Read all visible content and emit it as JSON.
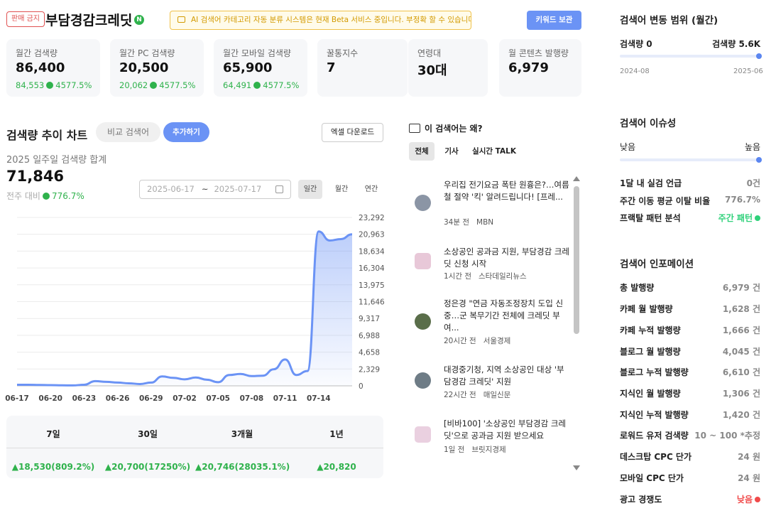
{
  "header": {
    "ban_badge": "판매 금지",
    "keyword": "부담경감크레딧",
    "n_icon": "N",
    "beta_note": "AI 검색어 카테고리 자동 분류 시스템은 현재 Beta 서비스 중입니다. 부정확 할 수 있습니다.",
    "keep_button": "키워드 보관"
  },
  "stats": [
    {
      "label": "월간 검색량",
      "value": "86,400",
      "sub_value": "84,553",
      "sub_pct": "4577.5%"
    },
    {
      "label": "월간 PC 검색량",
      "value": "20,500",
      "sub_value": "20,062",
      "sub_pct": "4577.5%"
    },
    {
      "label": "월간 모바일 검색량",
      "value": "65,900",
      "sub_value": "64,491",
      "sub_pct": "4577.5%"
    },
    {
      "label": "꿀통지수",
      "value": "7"
    },
    {
      "label": "연령대",
      "value": "30대"
    },
    {
      "label": "월 콘텐츠 발행량",
      "value": "6,979"
    }
  ],
  "trend": {
    "title": "검색량 추이 차트",
    "compare_button": "비교 검색어",
    "add_button": "추가하기",
    "excel_button": "엑셀 다운로드",
    "sum_label": "2025 일주일 검색량 합계",
    "sum_value": "71,846",
    "wow_label": "전주 대비",
    "wow_value": "776.7%",
    "date_from": "2025-06-17",
    "date_sep": "~",
    "date_to": "2025-07-17",
    "periods": [
      "일간",
      "월간",
      "연간"
    ],
    "active_period": "일간"
  },
  "chart_data": {
    "type": "area",
    "x_ticks": [
      "06-17",
      "06-20",
      "06-23",
      "06-26",
      "06-29",
      "07-02",
      "07-05",
      "07-08",
      "07-11",
      "07-14"
    ],
    "y_ticks": [
      "23,292",
      "20,963",
      "18,634",
      "16,304",
      "13,975",
      "11,646",
      "9,317",
      "6,988",
      "4,658",
      "2,329",
      "0"
    ],
    "ylim": [
      0,
      23292
    ],
    "x": [
      "06-17",
      "06-18",
      "06-19",
      "06-20",
      "06-21",
      "06-22",
      "06-23",
      "06-24",
      "06-25",
      "06-26",
      "06-27",
      "06-28",
      "06-29",
      "06-30",
      "07-01",
      "07-02",
      "07-03",
      "07-04",
      "07-05",
      "07-06",
      "07-07",
      "07-08",
      "07-09",
      "07-10",
      "07-11",
      "07-12",
      "07-13",
      "07-14",
      "07-15",
      "07-16",
      "07-17"
    ],
    "values": [
      150,
      150,
      120,
      100,
      70,
      60,
      150,
      650,
      550,
      450,
      350,
      250,
      450,
      1300,
      1100,
      900,
      1150,
      850,
      500,
      1500,
      1650,
      1350,
      1400,
      2300,
      3650,
      1500,
      2050,
      21350,
      20100,
      20300,
      20963
    ],
    "color": "#6b93f5"
  },
  "summary": [
    {
      "period": "7일",
      "value": "▲18,530(809.2%)"
    },
    {
      "period": "30일",
      "value": "▲20,700(17250%)"
    },
    {
      "period": "3개월",
      "value": "▲20,746(28035.1%)"
    },
    {
      "period": "1년",
      "value": "▲20,820"
    }
  ],
  "why": {
    "title": "이 검색어는 왜?",
    "tabs": [
      "전체",
      "기사",
      "실시간 TALK"
    ],
    "news": [
      {
        "title": "우리집 전기요금 폭탄 원흉은?…여름철 절약 '킥' 알려드립니다! [프레...",
        "time": "34분 전",
        "source": "MBN",
        "thumb_color": "#8b95a5"
      },
      {
        "title": "소상공인 공과금 지원, 부담경감 크레딧 신청 시작",
        "time": "1시간 전",
        "source": "스타데일리뉴스",
        "thumb_color": "#e8c8d8"
      },
      {
        "title": "정은경 \"연금 자동조정장치 도입 신중…군 복무기간 전체에 크레딧 부여...",
        "time": "20시간 전",
        "source": "서울경제",
        "thumb_color": "#5a6e4a"
      },
      {
        "title": "대경중기청, 지역 소상공인 대상 '부담경감 크레딧' 지원",
        "time": "22시간 전",
        "source": "매일신문",
        "thumb_color": "#6e7c86"
      },
      {
        "title": "[비바100] '소상공인 부담경감 크레딧'으로 공과금 지원 받으세요",
        "time": "1일 전",
        "source": "브릿지경제",
        "thumb_color": "#ead0e0"
      }
    ]
  },
  "range": {
    "title": "검색어 변동 범위 (월간)",
    "min_label": "검색량 0",
    "max_label": "검색량 5.6K",
    "start": "2024-08",
    "end": "2025-06",
    "level": 1.0
  },
  "issue": {
    "title": "검색어 이슈성",
    "low": "낮음",
    "high": "높음",
    "level": 1.0,
    "rows": [
      {
        "label": "1달 내 실검 언급",
        "value": "0건"
      },
      {
        "label": "주간 이동 평균 이탈 비율",
        "value": "776.7%"
      },
      {
        "label": "프랙탈 패턴 분석",
        "value": "주간 패턴"
      }
    ]
  },
  "info": {
    "title": "검색어 인포메이션",
    "rows": [
      {
        "label": "총 발행량",
        "value": "6,979 건"
      },
      {
        "label": "카페 월 발행량",
        "value": "1,628 건"
      },
      {
        "label": "카페 누적 발행량",
        "value": "1,666 건"
      },
      {
        "label": "블로그 월 발행량",
        "value": "4,045 건"
      },
      {
        "label": "블로그 누적 발행량",
        "value": "6,610 건"
      },
      {
        "label": "지식인 월 발행량",
        "value": "1,306 건"
      },
      {
        "label": "지식인 누적 발행량",
        "value": "1,420 건"
      },
      {
        "label": "로워드 유저 검색량",
        "value": "10 ~ 100 *추정"
      },
      {
        "label": "데스크탑 CPC 단가",
        "value": "24 원"
      },
      {
        "label": "모바일 CPC 단가",
        "value": "24 원"
      },
      {
        "label": "광고 경쟁도",
        "value": "낮음"
      }
    ]
  }
}
